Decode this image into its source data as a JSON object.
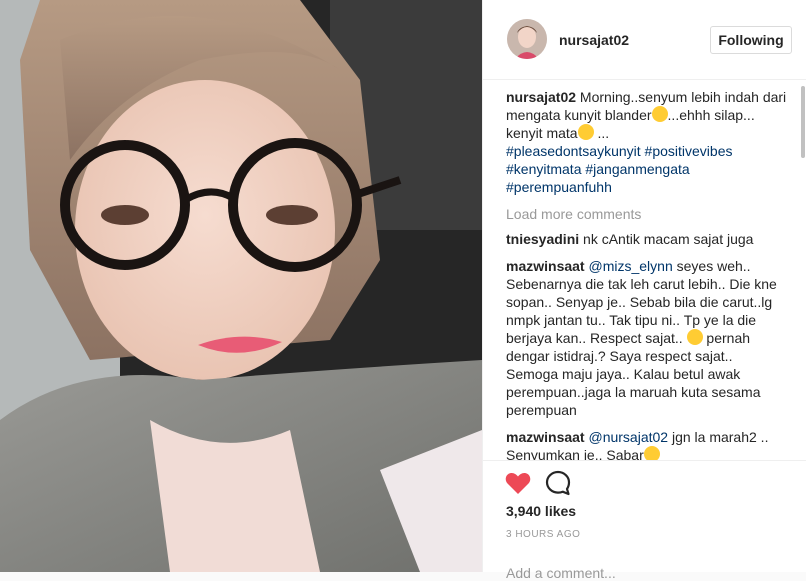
{
  "post": {
    "photo_icon": "selfie-photo"
  },
  "header": {
    "avatar_icon": "profile-avatar",
    "username": "nursajat02",
    "follow_label": "Following"
  },
  "caption": {
    "user": "nursajat02",
    "text1": " Morning..senyum lebih indah dari mengata kunyit blander",
    "text2": "...ehhh silap... kenyit mata",
    "text3": " ...",
    "hashtags": [
      "#pleasedontsaykunyit",
      "#positivevibes",
      "#kenyitmata",
      "#janganmengata",
      "#perempuanfuhh"
    ]
  },
  "load_more": "Load more comments",
  "comments": [
    {
      "user": "tniesyadini",
      "text": " nk cAntik macam sajat juga"
    },
    {
      "user": "mazwinsaat",
      "mention": "@mizs_elynn",
      "text": " seyes weh.. Sebenarnya die tak leh carut lebih.. Die kne sopan.. Senyap je.. Sebab bila die carut..lg nmpk jantan tu.. Tak tipu ni.. Tp ye la die berjaya kan.. Respect sajat.. ",
      "text_after": " pernah dengar istidraj.? Saya respect sajat.. Semoga maju jaya.. Kalau betul awak perempuan..jaga la maruah kuta sesama perempuan"
    },
    {
      "user": "mazwinsaat",
      "mention": "@nursajat02",
      "text": " jgn la marah2 .. Senyumkan je.. Sabar"
    }
  ],
  "actions": {
    "like_icon": "heart-icon",
    "comment_icon": "comment-bubble-icon",
    "likes": "3,940 likes",
    "time": "3 HOURS AGO",
    "add_comment_placeholder": "Add a comment..."
  },
  "colors": {
    "heart": "#ed4956",
    "hashtag": "#003569",
    "muted": "#999999"
  }
}
